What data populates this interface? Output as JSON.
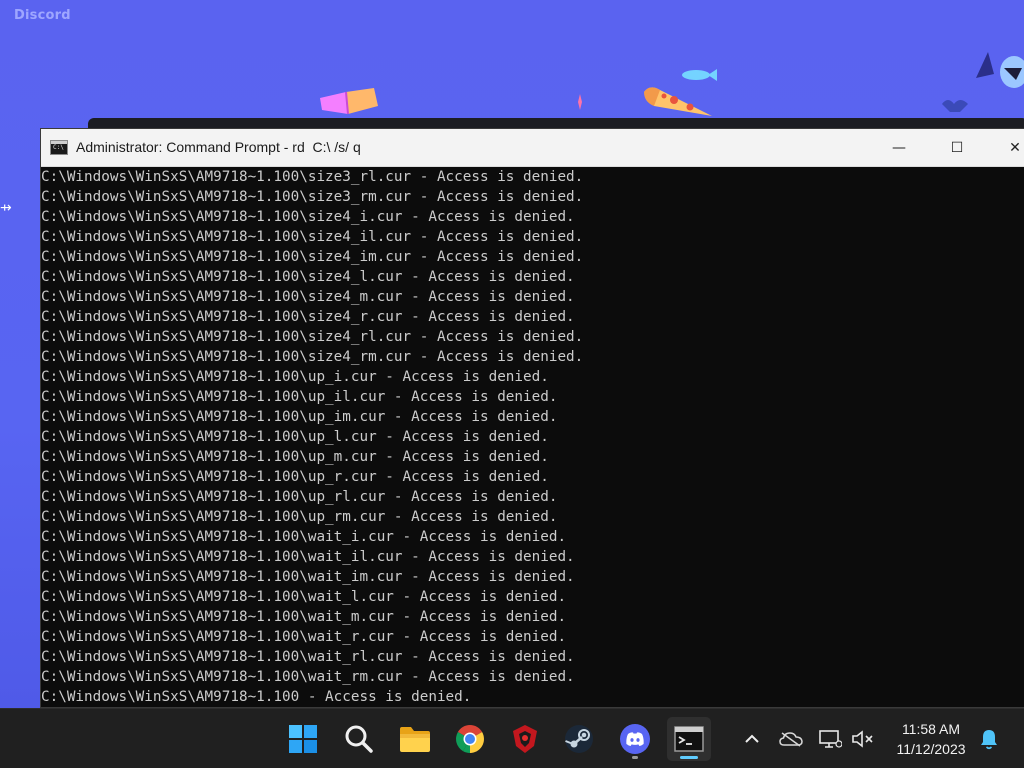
{
  "background_app": {
    "title": "Discord"
  },
  "cmd_window": {
    "title": "Administrator: Command Prompt - rd  C:\\ /s/ q",
    "controls": {
      "minimize": "—",
      "maximize": "☐",
      "close": "✕"
    },
    "output_lines": [
      "C:\\Windows\\WinSxS\\AM9718~1.100\\size3_rl.cur - Access is denied.",
      "C:\\Windows\\WinSxS\\AM9718~1.100\\size3_rm.cur - Access is denied.",
      "C:\\Windows\\WinSxS\\AM9718~1.100\\size4_i.cur - Access is denied.",
      "C:\\Windows\\WinSxS\\AM9718~1.100\\size4_il.cur - Access is denied.",
      "C:\\Windows\\WinSxS\\AM9718~1.100\\size4_im.cur - Access is denied.",
      "C:\\Windows\\WinSxS\\AM9718~1.100\\size4_l.cur - Access is denied.",
      "C:\\Windows\\WinSxS\\AM9718~1.100\\size4_m.cur - Access is denied.",
      "C:\\Windows\\WinSxS\\AM9718~1.100\\size4_r.cur - Access is denied.",
      "C:\\Windows\\WinSxS\\AM9718~1.100\\size4_rl.cur - Access is denied.",
      "C:\\Windows\\WinSxS\\AM9718~1.100\\size4_rm.cur - Access is denied.",
      "C:\\Windows\\WinSxS\\AM9718~1.100\\up_i.cur - Access is denied.",
      "C:\\Windows\\WinSxS\\AM9718~1.100\\up_il.cur - Access is denied.",
      "C:\\Windows\\WinSxS\\AM9718~1.100\\up_im.cur - Access is denied.",
      "C:\\Windows\\WinSxS\\AM9718~1.100\\up_l.cur - Access is denied.",
      "C:\\Windows\\WinSxS\\AM9718~1.100\\up_m.cur - Access is denied.",
      "C:\\Windows\\WinSxS\\AM9718~1.100\\up_r.cur - Access is denied.",
      "C:\\Windows\\WinSxS\\AM9718~1.100\\up_rl.cur - Access is denied.",
      "C:\\Windows\\WinSxS\\AM9718~1.100\\up_rm.cur - Access is denied.",
      "C:\\Windows\\WinSxS\\AM9718~1.100\\wait_i.cur - Access is denied.",
      "C:\\Windows\\WinSxS\\AM9718~1.100\\wait_il.cur - Access is denied.",
      "C:\\Windows\\WinSxS\\AM9718~1.100\\wait_im.cur - Access is denied.",
      "C:\\Windows\\WinSxS\\AM9718~1.100\\wait_l.cur - Access is denied.",
      "C:\\Windows\\WinSxS\\AM9718~1.100\\wait_m.cur - Access is denied.",
      "C:\\Windows\\WinSxS\\AM9718~1.100\\wait_r.cur - Access is denied.",
      "C:\\Windows\\WinSxS\\AM9718~1.100\\wait_rl.cur - Access is denied.",
      "C:\\Windows\\WinSxS\\AM9718~1.100\\wait_rm.cur - Access is denied.",
      "C:\\Windows\\WinSxS\\AM9718~1.100 - Access is denied."
    ]
  },
  "taskbar": {
    "apps": [
      {
        "name": "start",
        "icon": "windows-logo-icon"
      },
      {
        "name": "search",
        "icon": "search-icon"
      },
      {
        "name": "file-explorer",
        "icon": "folder-icon"
      },
      {
        "name": "chrome",
        "icon": "chrome-icon"
      },
      {
        "name": "app-red",
        "icon": "red-shield-icon"
      },
      {
        "name": "steam",
        "icon": "steam-icon"
      },
      {
        "name": "discord",
        "icon": "discord-icon",
        "running": true
      },
      {
        "name": "command-prompt",
        "icon": "terminal-icon",
        "active": true
      }
    ],
    "tray": {
      "icons": [
        "chevron-up-icon",
        "onedrive-icon",
        "network-icon",
        "volume-muted-icon"
      ]
    },
    "clock": {
      "time": "11:58 AM",
      "date": "11/12/2023"
    },
    "notification_icon": "bell-icon"
  },
  "colors": {
    "discord_blurple": "#5865f2",
    "console_bg": "#0c0c0c",
    "console_text": "#cccccc",
    "taskbar_bg": "#202020",
    "accent": "#60cdff"
  }
}
